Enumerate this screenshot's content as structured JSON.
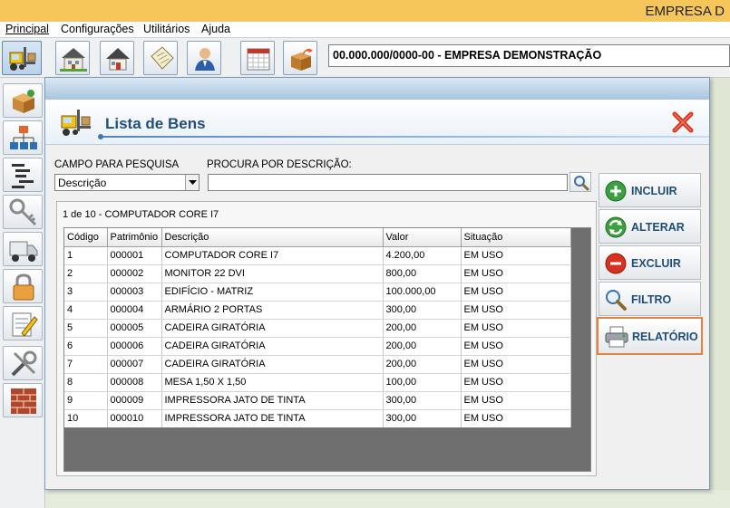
{
  "app": {
    "title": "EMPRESA D",
    "company": "00.000.000/0000-00 - EMPRESA DEMONSTRAÇÃO"
  },
  "menu": {
    "principal": "Principal",
    "configuracoes": "Configurações",
    "utilitarios": "Utilitários",
    "ajuda": "Ajuda"
  },
  "window": {
    "title": "Lista de Bens",
    "campo_label": "CAMPO PARA PESQUISA",
    "campo_value": "Descrição",
    "procura_label": "PROCURA POR DESCRIÇÃO:",
    "procura_value": "",
    "status": "1 de 10 - COMPUTADOR CORE I7"
  },
  "grid": {
    "headers": [
      "Código",
      "Patrimônio",
      "Descrição",
      "Valor",
      "Situação"
    ],
    "rows": [
      [
        "1",
        "000001",
        "COMPUTADOR CORE I7",
        "4.200,00",
        "EM USO"
      ],
      [
        "2",
        "000002",
        "MONITOR 22 DVI",
        "800,00",
        "EM USO"
      ],
      [
        "3",
        "000003",
        "EDIFÍCIO - MATRIZ",
        "100.000,00",
        "EM USO"
      ],
      [
        "4",
        "000004",
        "ARMÁRIO 2 PORTAS",
        "300,00",
        "EM USO"
      ],
      [
        "5",
        "000005",
        "CADEIRA GIRATÓRIA",
        "200,00",
        "EM USO"
      ],
      [
        "6",
        "000006",
        "CADEIRA GIRATÓRIA",
        "200,00",
        "EM USO"
      ],
      [
        "7",
        "000007",
        "CADEIRA GIRATÓRIA",
        "200,00",
        "EM USO"
      ],
      [
        "8",
        "000008",
        "MESA 1,50 X 1,50",
        "100,00",
        "EM USO"
      ],
      [
        "9",
        "000009",
        "IMPRESSORA JATO DE TINTA",
        "300,00",
        "EM USO"
      ],
      [
        "10",
        "000010",
        "IMPRESSORA JATO DE TINTA",
        "300,00",
        "EM USO"
      ]
    ]
  },
  "actions": {
    "incluir": "INCLUIR",
    "alterar": "ALTERAR",
    "excluir": "EXCLUIR",
    "filtro": "FILTRO",
    "relatorio": "RELATÓRIO"
  },
  "colors": {
    "titlebar": "#f6c65a",
    "accent_blue": "#234f7c",
    "selected_border": "#e8823a"
  },
  "icons": {
    "toolbar": [
      "forklift-icon",
      "farm-house-icon",
      "house-icon",
      "document-icon",
      "user-icon",
      "calendar-icon",
      "box-open-icon"
    ],
    "sidebar": [
      "boxes-icon",
      "org-chart-icon",
      "list-tree-icon",
      "key-icon",
      "truck-icon",
      "padlock-icon",
      "notepad-icon",
      "tools-icon",
      "brick-wall-icon"
    ]
  }
}
